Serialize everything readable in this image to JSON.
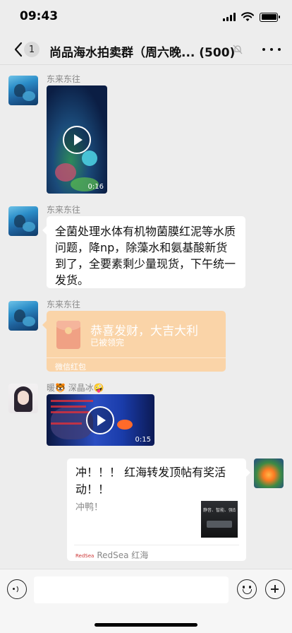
{
  "status_bar": {
    "time": "09:43"
  },
  "nav": {
    "unread_count": "1",
    "title": "尚品海水拍卖群（周六晚...  (500)"
  },
  "messages": [
    {
      "type": "video",
      "sender": "东来东往",
      "duration": "0:16"
    },
    {
      "type": "text",
      "sender": "东来东往",
      "text": "全菌处理水体有机物菌膜红泥等水质问题，降np，除藻水和氨基酸新货到了，全要素剩少量现货，下午统一发货。"
    },
    {
      "type": "red_packet",
      "sender": "东来东往",
      "title": "恭喜发财，大吉大利",
      "status": "已被领完",
      "label": "微信红包"
    },
    {
      "type": "video",
      "sender": "暖🐯 深晶冰🤪",
      "duration": "0:15"
    },
    {
      "type": "share_card",
      "sender": "me",
      "title": "冲！！！ 红海转发顶帖有奖活动！！",
      "desc": "冲鸭！",
      "thumb_text": "静音、智能、强劲",
      "source_logo": "RedSea",
      "source": "RedSea 红海"
    }
  ],
  "input_bar": {
    "placeholder": ""
  },
  "colors": {
    "background": "#ededed",
    "red_packet": "#fad4a8",
    "bubble": "#ffffff"
  }
}
